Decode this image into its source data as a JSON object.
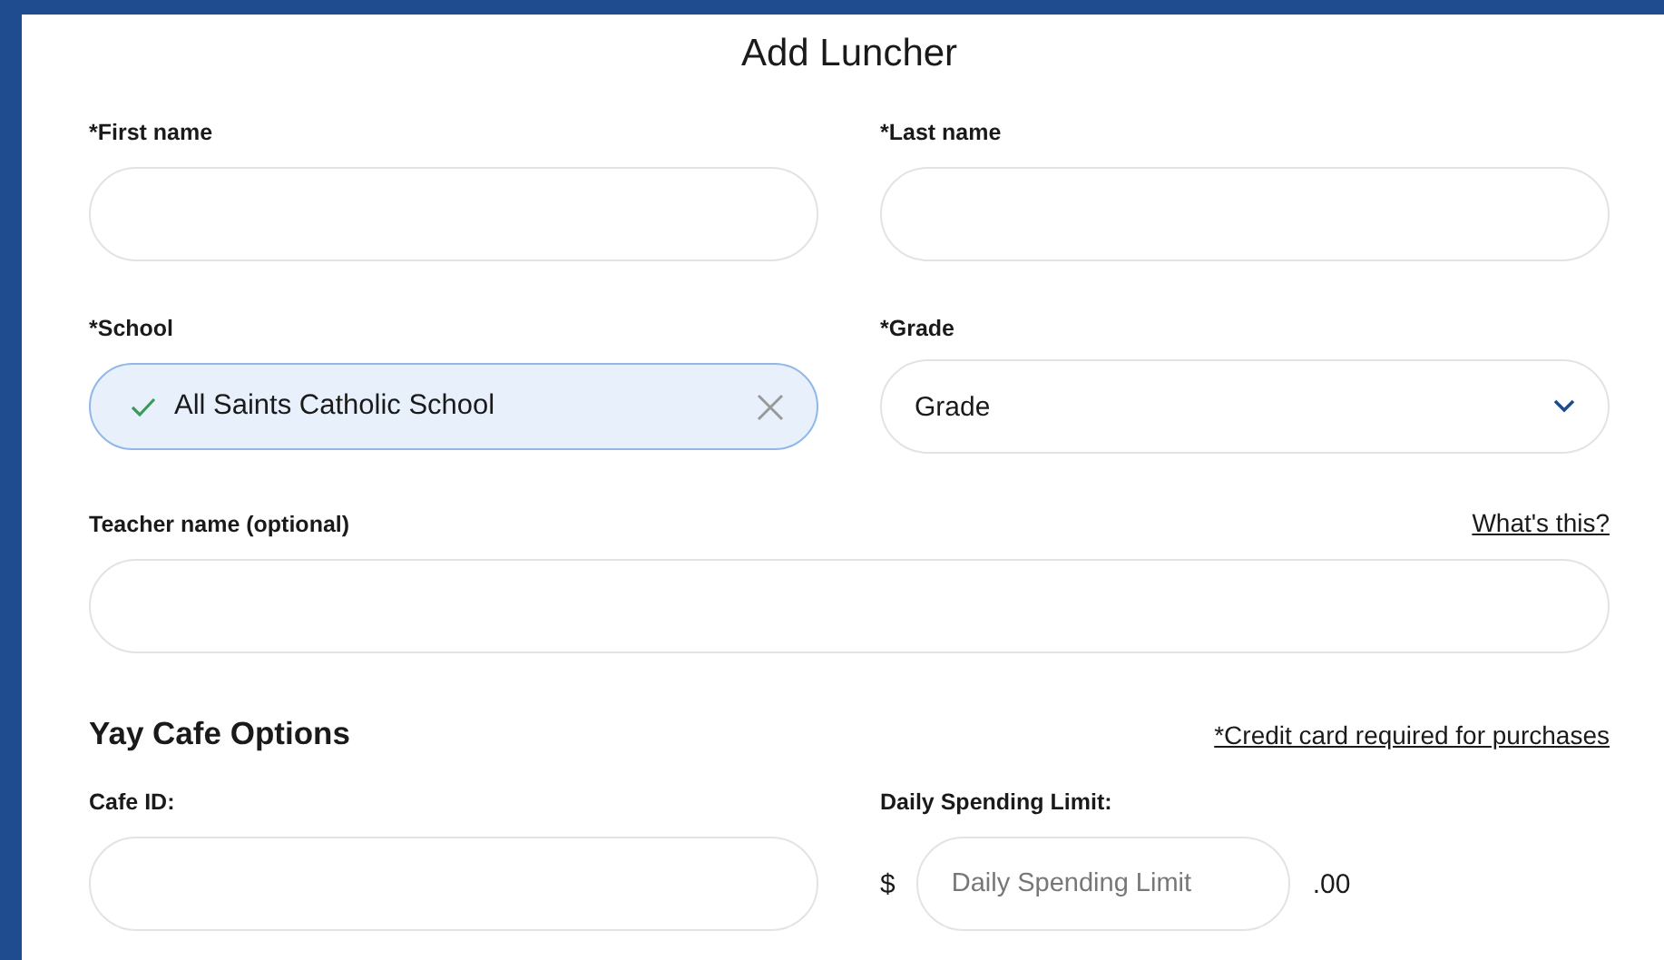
{
  "title": "Add Luncher",
  "fields_row_1": [
    {
      "label": "*First name"
    },
    {
      "label": "*Last name"
    }
  ],
  "school": {
    "label": "*School",
    "value": "All Saints Catholic School",
    "valid": true
  },
  "grade": {
    "label": "*Grade",
    "value": "Grade"
  },
  "teacher": {
    "label": "Teacher name (optional)",
    "link": "What's this?"
  },
  "cafe": {
    "heading": "Yay Cafe Options",
    "note": "*Credit card required for purchases",
    "cafe_id": {
      "label": "Cafe ID:"
    },
    "limit": {
      "label": "Daily Spending Limit:",
      "currency": "$",
      "placeholder": "Daily Spending Limit",
      "suffix": ".00"
    }
  }
}
